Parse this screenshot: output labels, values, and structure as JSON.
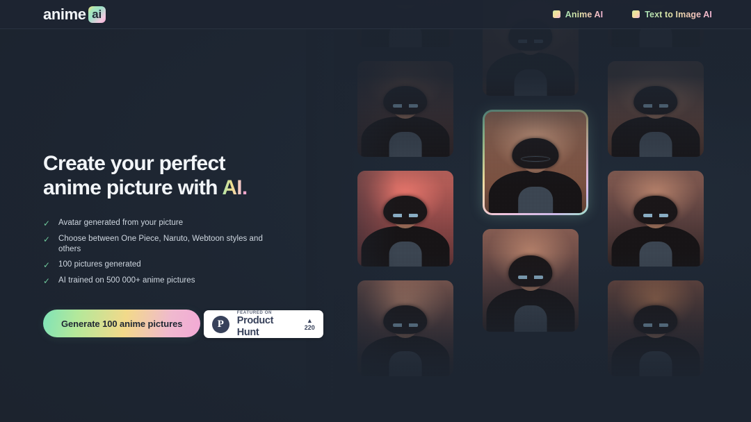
{
  "header": {
    "logo": {
      "text": "anime",
      "badge": "ai"
    },
    "nav": [
      {
        "label": "Anime AI",
        "icon": "gradient-square-icon"
      },
      {
        "label": "Text to Image AI",
        "icon": "gradient-square-icon"
      }
    ]
  },
  "hero": {
    "headline_line1": "Create your perfect",
    "headline_line2_pre": "anime picture with ",
    "headline_highlight": "AI",
    "headline_period": ".",
    "features": [
      "Avatar generated from your picture",
      "Choose between One Piece, Naruto, Webtoon styles and others",
      "100 pictures generated",
      "AI trained on 500 000+ anime pictures"
    ],
    "cta_label": "Generate 100 anime pictures",
    "product_hunt": {
      "logo_letter": "P",
      "featured_on": "FEATURED ON",
      "name": "Product Hunt",
      "arrow": "▲",
      "votes": "220"
    }
  },
  "gallery": {
    "columns": [
      {
        "name": "left-column",
        "cards": [
          {
            "style": "art-night",
            "variant": "anime-portrait-dark"
          },
          {
            "style": "art-rain",
            "variant": "anime-portrait-rain"
          },
          {
            "style": "art-sunset",
            "variant": "anime-portrait-sunset"
          },
          {
            "style": "art-dusk",
            "variant": "anime-portrait-dusk"
          }
        ]
      },
      {
        "name": "center-column",
        "cards": [
          {
            "style": "art-indoor",
            "variant": "photo-portrait-top"
          },
          {
            "style": "art-photo",
            "variant": "photo-portrait-featured",
            "featured": true
          },
          {
            "style": "art-dusk",
            "variant": "anime-portrait-bottom"
          }
        ]
      },
      {
        "name": "right-column",
        "cards": [
          {
            "style": "art-night",
            "variant": "anime-portrait-dark-r"
          },
          {
            "style": "art-indoor",
            "variant": "anime-portrait-indoor"
          },
          {
            "style": "art-dusk",
            "variant": "anime-portrait-dusk-r"
          },
          {
            "style": "art-rain",
            "variant": "anime-portrait-rain-r"
          }
        ]
      }
    ]
  },
  "colors": {
    "background": "#1d2531",
    "header_border": "#2a3340",
    "text_primary": "#f2f5f8",
    "text_secondary": "#cfd7e0",
    "check_green": "#6fc99b",
    "gradient_start": "#7fe3b8",
    "gradient_mid": "#f2d98a",
    "gradient_end": "#f2a9d6",
    "badge_white": "#ffffff",
    "product_hunt_navy": "#37415a"
  }
}
